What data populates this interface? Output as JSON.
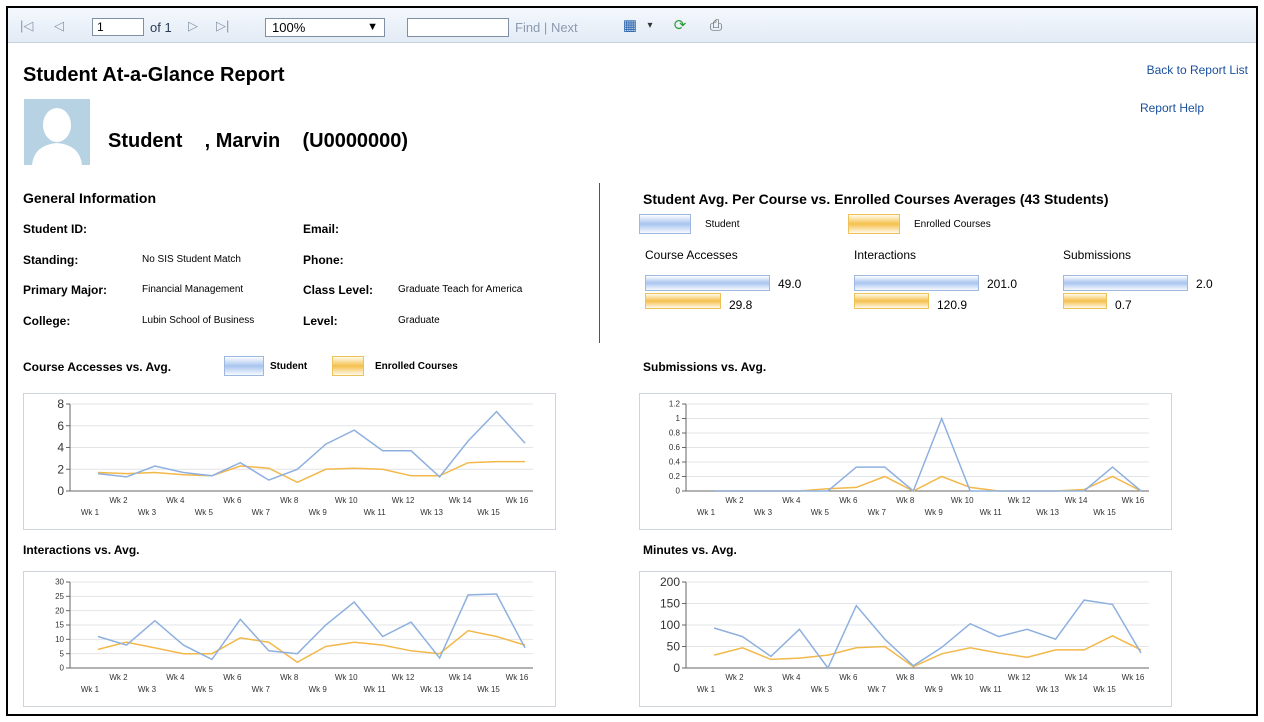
{
  "toolbar": {
    "page_value": "1",
    "page_of": "of 1",
    "zoom": "100%",
    "find_placeholder": "",
    "find_label": "Find",
    "separator": "|",
    "next_label": "Next",
    "icons": [
      "first-page-icon",
      "prev-page-icon",
      "next-page-icon",
      "last-page-icon",
      "export-icon",
      "refresh-icon",
      "print-icon"
    ]
  },
  "report": {
    "title": "Student At-a-Glance Report",
    "back_link": "Back to Report List",
    "help_link": "Report Help",
    "student_name": "Student    , Marvin    (U0000000)"
  },
  "general": {
    "heading": "General Information",
    "student_id_label": "Student ID:",
    "student_id_value": "",
    "standing_label": "Standing:",
    "standing_value": "No SIS Student Match",
    "major_label": "Primary Major:",
    "major_value": "Financial Management",
    "college_label": "College:",
    "college_value": "Lubin School of Business",
    "email_label": "Email:",
    "email_value": "",
    "phone_label": "Phone:",
    "phone_value": "",
    "class_level_label": "Class Level:",
    "class_level_value": "Graduate Teach for America",
    "level_label": "Level:",
    "level_value": "Graduate"
  },
  "averages": {
    "heading": "Student Avg. Per Course vs. Enrolled Courses Averages (43 Students)",
    "legend_student": "Student",
    "legend_enrolled": "Enrolled Courses",
    "metrics": [
      {
        "label": "Course Accesses",
        "student": 49.0,
        "enrolled": 29.8,
        "student_text": "49.0",
        "enrolled_text": "29.8"
      },
      {
        "label": "Interactions",
        "student": 201.0,
        "enrolled": 120.9,
        "student_text": "201.0",
        "enrolled_text": "120.9"
      },
      {
        "label": "Submissions",
        "student": 2.0,
        "enrolled": 0.7,
        "student_text": "2.0",
        "enrolled_text": "0.7"
      }
    ]
  },
  "legend": {
    "student": "Student",
    "enrolled": "Enrolled Courses"
  },
  "colors": {
    "student_line": "#8eb0df",
    "enrolled_line": "#f3b84a"
  },
  "chart_data": [
    {
      "type": "line",
      "title": "Course Accesses vs. Avg.",
      "categories": [
        "Wk 1",
        "Wk 2",
        "Wk 3",
        "Wk 4",
        "Wk 5",
        "Wk 6",
        "Wk 7",
        "Wk 8",
        "Wk 9",
        "Wk 10",
        "Wk 11",
        "Wk 12",
        "Wk 13",
        "Wk 14",
        "Wk 15",
        "Wk 16"
      ],
      "yticks": [
        0,
        2,
        4,
        6,
        8
      ],
      "ylim": [
        0,
        8
      ],
      "series": [
        {
          "name": "Student",
          "values": [
            1.6,
            1.3,
            2.3,
            1.7,
            1.4,
            2.6,
            1.0,
            2.0,
            4.3,
            5.6,
            3.7,
            3.7,
            1.3,
            4.6,
            7.3,
            4.4
          ]
        },
        {
          "name": "Enrolled Courses",
          "values": [
            1.7,
            1.6,
            1.7,
            1.5,
            1.4,
            2.3,
            2.1,
            0.8,
            2.0,
            2.1,
            2.0,
            1.4,
            1.4,
            2.6,
            2.7,
            2.7
          ]
        }
      ]
    },
    {
      "type": "line",
      "title": "Submissions vs. Avg.",
      "categories": [
        "Wk 1",
        "Wk 2",
        "Wk 3",
        "Wk 4",
        "Wk 5",
        "Wk 6",
        "Wk 7",
        "Wk 8",
        "Wk 9",
        "Wk 10",
        "Wk 11",
        "Wk 12",
        "Wk 13",
        "Wk 14",
        "Wk 15",
        "Wk 16"
      ],
      "yticks": [
        0,
        0.2,
        0.4,
        0.6,
        0.8,
        1,
        1.2
      ],
      "ylim": [
        0,
        1.2
      ],
      "series": [
        {
          "name": "Student",
          "values": [
            0,
            0,
            0,
            0,
            0,
            0.33,
            0.33,
            0,
            1.0,
            0,
            0,
            0,
            0,
            0,
            0.33,
            0
          ]
        },
        {
          "name": "Enrolled Courses",
          "values": [
            0,
            0,
            0,
            0,
            0.03,
            0.05,
            0.2,
            0,
            0.2,
            0.05,
            0,
            0,
            0,
            0.02,
            0.2,
            0
          ]
        }
      ]
    },
    {
      "type": "line",
      "title": "Interactions vs. Avg.",
      "categories": [
        "Wk 1",
        "Wk 2",
        "Wk 3",
        "Wk 4",
        "Wk 5",
        "Wk 6",
        "Wk 7",
        "Wk 8",
        "Wk 9",
        "Wk 10",
        "Wk 11",
        "Wk 12",
        "Wk 13",
        "Wk 14",
        "Wk 15",
        "Wk 16"
      ],
      "yticks": [
        0,
        5,
        10,
        15,
        20,
        25,
        30
      ],
      "ylim": [
        0,
        30
      ],
      "series": [
        {
          "name": "Student",
          "values": [
            11,
            8,
            16.5,
            8,
            3,
            17,
            6,
            5,
            15,
            23,
            11,
            16,
            3.5,
            25.5,
            25.8,
            7
          ]
        },
        {
          "name": "Enrolled Courses",
          "values": [
            6.5,
            9,
            7,
            5,
            5,
            10.5,
            9,
            2,
            7.5,
            9,
            8,
            6,
            5,
            13,
            11,
            8
          ]
        }
      ]
    },
    {
      "type": "line",
      "title": "Minutes vs. Avg.",
      "categories": [
        "Wk 1",
        "Wk 2",
        "Wk 3",
        "Wk 4",
        "Wk 5",
        "Wk 6",
        "Wk 7",
        "Wk 8",
        "Wk 9",
        "Wk 10",
        "Wk 11",
        "Wk 12",
        "Wk 13",
        "Wk 14",
        "Wk 15",
        "Wk 16"
      ],
      "yticks": [
        0,
        50,
        100,
        150,
        200
      ],
      "ylim": [
        0,
        200
      ],
      "series": [
        {
          "name": "Student",
          "values": [
            93,
            73,
            27,
            90,
            0,
            145,
            67,
            5,
            48,
            103,
            73,
            90,
            67,
            158,
            148,
            35
          ]
        },
        {
          "name": "Enrolled Courses",
          "values": [
            30,
            47,
            20,
            23,
            30,
            47,
            50,
            3,
            33,
            47,
            35,
            25,
            42,
            42,
            75,
            42
          ]
        }
      ]
    }
  ]
}
